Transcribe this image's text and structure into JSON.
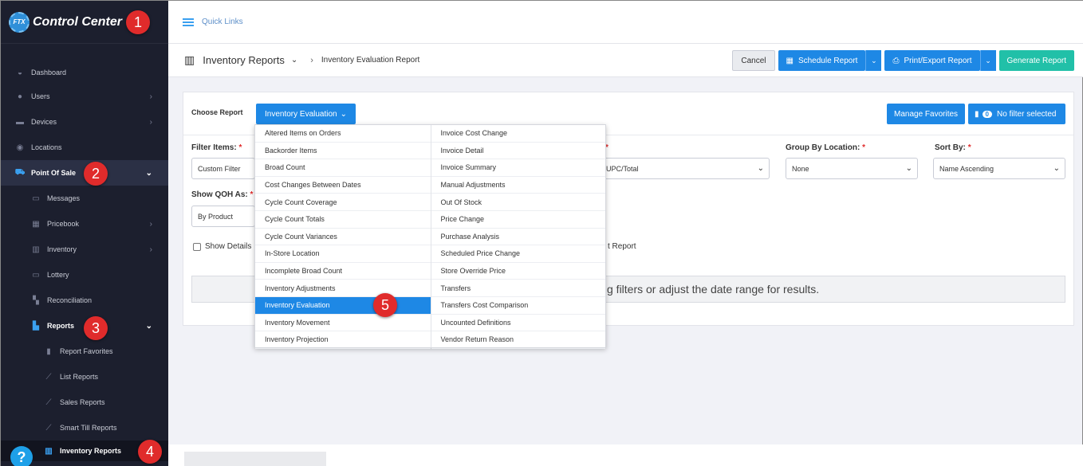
{
  "app": {
    "logo_text": "Control Center",
    "logo_mark": "FTX"
  },
  "sidebar": {
    "items": [
      {
        "label": "Dashboard",
        "icon": "gauge-icon"
      },
      {
        "label": "Users",
        "icon": "users-icon"
      },
      {
        "label": "Devices",
        "icon": "devices-icon"
      },
      {
        "label": "Locations",
        "icon": "location-pin-icon"
      },
      {
        "label": "Point Of Sale",
        "icon": "cart-icon"
      },
      {
        "label": "Messages",
        "icon": "message-icon"
      },
      {
        "label": "Pricebook",
        "icon": "calculator-icon"
      },
      {
        "label": "Inventory",
        "icon": "warehouse-icon"
      },
      {
        "label": "Lottery",
        "icon": "ticket-icon"
      },
      {
        "label": "Reconciliation",
        "icon": "grid-icon"
      },
      {
        "label": "Reports",
        "icon": "bar-chart-icon"
      },
      {
        "label": "Report Favorites",
        "icon": "bookmark-icon"
      },
      {
        "label": "List Reports",
        "icon": "line-chart-icon"
      },
      {
        "label": "Sales Reports",
        "icon": "line-chart-icon"
      },
      {
        "label": "Smart Till Reports",
        "icon": "line-chart-icon"
      },
      {
        "label": "Inventory Reports",
        "icon": "warehouse-icon"
      }
    ],
    "help_label": "?"
  },
  "callouts": [
    "1",
    "2",
    "3",
    "4",
    "5"
  ],
  "topbar": {
    "quick_links": "Quick Links"
  },
  "page_header": {
    "title": "Inventory Reports",
    "breadcrumb": "Inventory Evaluation Report",
    "cancel": "Cancel",
    "schedule": "Schedule Report",
    "print_export": "Print/Export Report",
    "generate": "Generate Report"
  },
  "report_panel": {
    "choose_label": "Choose Report",
    "selected_report": "Inventory Evaluation",
    "manage_favorites": "Manage Favorites",
    "filter_count": "0",
    "no_filter": "No filter selected",
    "filter_items_label": "Filter Items:",
    "filter_items_value": "Custom Filter",
    "hidden_select_value": "UPC/Total",
    "group_by_label": "Group By Location:",
    "group_by_value": "None",
    "sort_by_label": "Sort By:",
    "sort_by_value": "Name Ascending",
    "show_qoh_label": "Show QOH As:",
    "show_qoh_value": "By Product",
    "show_details": "Show Details",
    "report_suffix": "t Report",
    "message_partial": "g filters or adjust the date range for results.",
    "required_mark": "*"
  },
  "dropdown": {
    "col1": [
      "Altered Items on Orders",
      "Backorder Items",
      "Broad Count",
      "Cost Changes Between Dates",
      "Cycle Count Coverage",
      "Cycle Count Totals",
      "Cycle Count Variances",
      "In-Store Location",
      "Incomplete Broad Count",
      "Inventory Adjustments",
      "Inventory Evaluation",
      "Inventory Movement",
      "Inventory Projection"
    ],
    "col2": [
      "Invoice Cost Change",
      "Invoice Detail",
      "Invoice Summary",
      "Manual Adjustments",
      "Out Of Stock",
      "Price Change",
      "Purchase Analysis",
      "Scheduled Price Change",
      "Store Override Price",
      "Transfers",
      "Transfers Cost Comparison",
      "Uncounted Definitions",
      "Vendor Return Reason"
    ],
    "selected": "Inventory Evaluation"
  },
  "colors": {
    "sidebar_bg": "#1c1f2e",
    "accent_blue": "#1e88e5",
    "teal": "#21c0a8",
    "callout_red": "#e02b2b"
  }
}
